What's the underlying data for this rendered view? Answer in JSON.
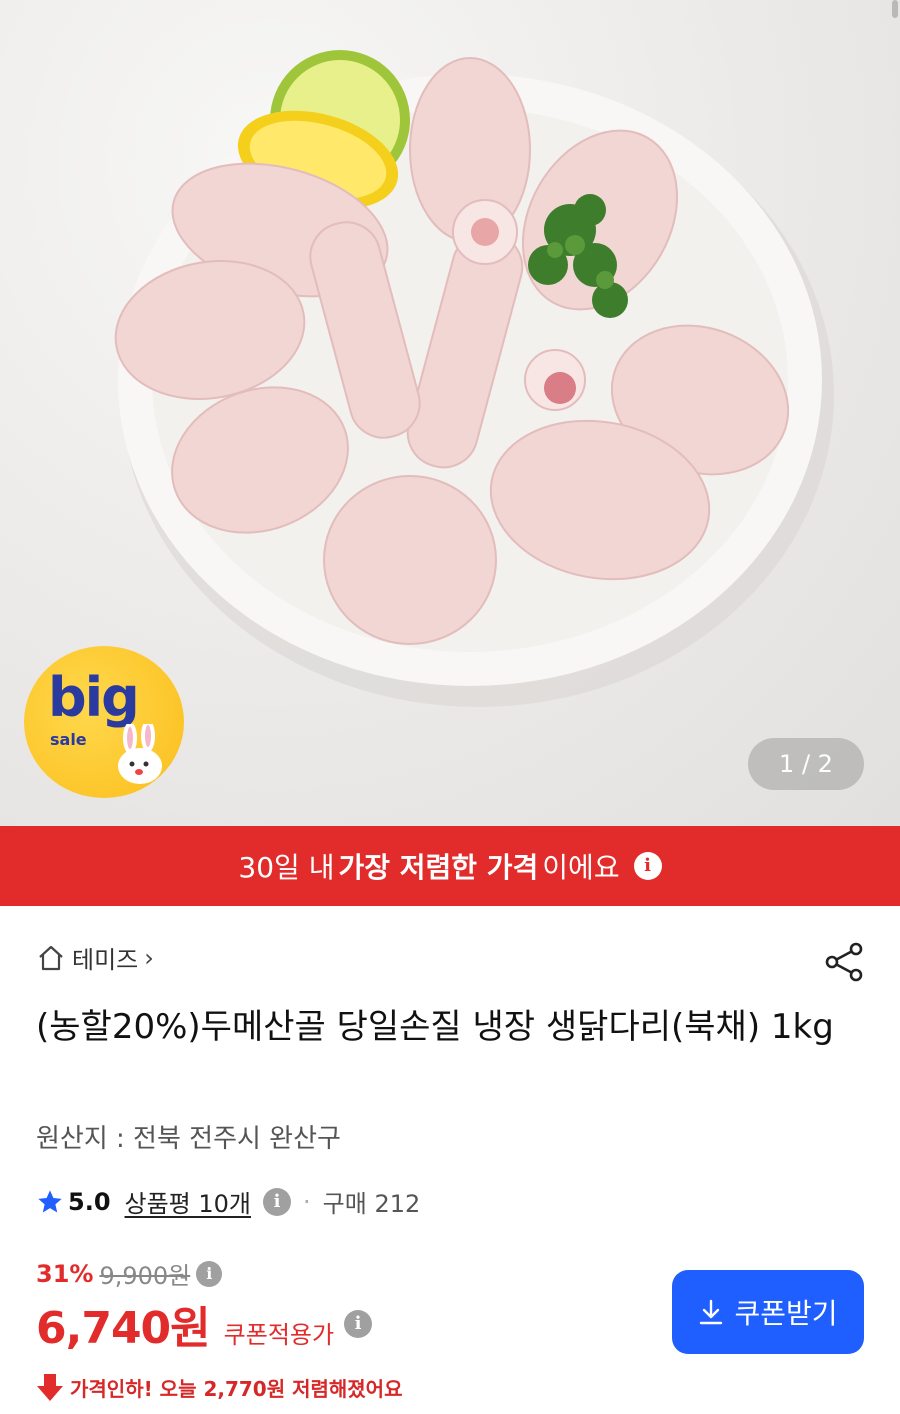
{
  "hero": {
    "pager_current": "1",
    "pager_total": "2",
    "badge": {
      "big": "big",
      "sale": "sale"
    }
  },
  "banner": {
    "prefix": "30일 내",
    "highlight": "가장 저렴한 가격",
    "suffix": "이에요",
    "info_icon": "i"
  },
  "store": {
    "name": "테미즈",
    "chevron": "›"
  },
  "product": {
    "title": "(농할20%)두메산골 당일손질 냉장 생닭다리(북채) 1kg",
    "origin": "원산지 : 전북 전주시 완산구"
  },
  "rating": {
    "score": "5.0",
    "reviews": "상품평 10개",
    "help_icon": "i",
    "separator": "·",
    "purchases": "구매 212"
  },
  "pricing": {
    "discount_pct": "31%",
    "original_price": "9,900원",
    "price": "6,740원",
    "coupon_price_label": "쿠폰적용가",
    "price_drop_text": "가격인하! 오늘 2,770원 저렴해졌어요"
  },
  "coupon_button": {
    "label": "쿠폰받기"
  },
  "colors": {
    "accent_red": "#e22b2b",
    "button_blue": "#1f5fff",
    "star_blue": "#1f5fff"
  },
  "icons": {
    "home": "home-icon",
    "share": "share-icon",
    "star": "star-icon",
    "download": "download-icon",
    "down_arrow": "down-arrow-icon"
  }
}
